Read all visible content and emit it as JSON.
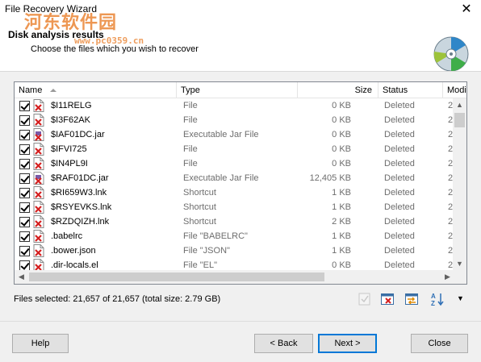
{
  "window": {
    "title": "File Recovery Wizard",
    "close_glyph": "✕"
  },
  "watermark": {
    "text": "河东软件园",
    "url": "www.pc0359.cn"
  },
  "header": {
    "title": "Disk analysis results",
    "subtitle": "Choose the files which you wish to recover",
    "icon": "disc-icon"
  },
  "list": {
    "columns": {
      "name": "Name",
      "type": "Type",
      "size": "Size",
      "status": "Status",
      "modified": "Modi"
    },
    "rows": [
      {
        "name": "$I11RELG",
        "type": "File",
        "size": "0 KB",
        "status": "Deleted",
        "modified": "2"
      },
      {
        "name": "$I3F62AK",
        "type": "File",
        "size": "0 KB",
        "status": "Deleted",
        "modified": "2"
      },
      {
        "name": "$IAF01DC.jar",
        "type": "Executable Jar File",
        "size": "0 KB",
        "status": "Deleted",
        "modified": "2"
      },
      {
        "name": "$IFVI725",
        "type": "File",
        "size": "0 KB",
        "status": "Deleted",
        "modified": "2"
      },
      {
        "name": "$IN4PL9I",
        "type": "File",
        "size": "0 KB",
        "status": "Deleted",
        "modified": "2"
      },
      {
        "name": "$RAF01DC.jar",
        "type": "Executable Jar File",
        "size": "12,405 KB",
        "status": "Deleted",
        "modified": "2"
      },
      {
        "name": "$RI659W3.lnk",
        "type": "Shortcut",
        "size": "1 KB",
        "status": "Deleted",
        "modified": "2"
      },
      {
        "name": "$RSYEVKS.lnk",
        "type": "Shortcut",
        "size": "1 KB",
        "status": "Deleted",
        "modified": "2"
      },
      {
        "name": "$RZDQIZH.lnk",
        "type": "Shortcut",
        "size": "2 KB",
        "status": "Deleted",
        "modified": "2"
      },
      {
        "name": ".babelrc",
        "type": "File \"BABELRC\"",
        "size": "1 KB",
        "status": "Deleted",
        "modified": "2"
      },
      {
        "name": ".bower.json",
        "type": "File \"JSON\"",
        "size": "1 KB",
        "status": "Deleted",
        "modified": "2"
      },
      {
        "name": ".dir-locals.el",
        "type": "File \"EL\"",
        "size": "0 KB",
        "status": "Deleted",
        "modified": "2"
      }
    ]
  },
  "selection_info": "Files selected: 21,657 of 21,657 (total size: 2.79 GB)",
  "buttons": {
    "help": "Help",
    "back": "< Back",
    "next": "Next >",
    "close": "Close"
  },
  "colors": {
    "accent": "#0078d7",
    "deleted_icon": "#d42020",
    "watermark": "#e8751a"
  }
}
